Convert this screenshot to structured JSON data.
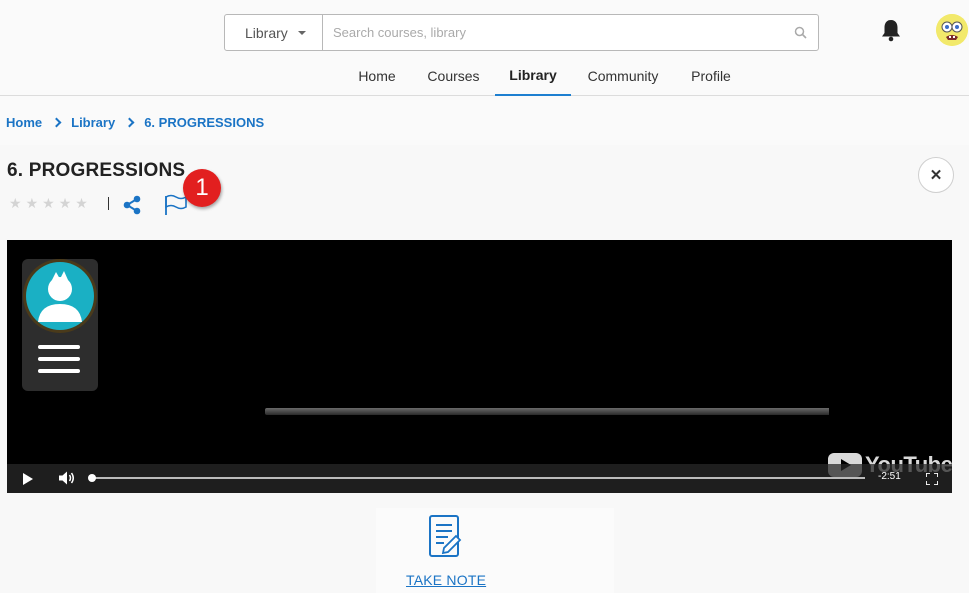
{
  "search": {
    "category": "Library",
    "placeholder": "Search courses, library"
  },
  "nav": {
    "items": [
      {
        "label": "Home"
      },
      {
        "label": "Courses"
      },
      {
        "label": "Library",
        "active": true
      },
      {
        "label": "Community"
      },
      {
        "label": "Profile"
      }
    ]
  },
  "breadcrumb": [
    "Home",
    "Library",
    "6. PROGRESSIONS"
  ],
  "item": {
    "title": "6. PROGRESSIONS",
    "rating": 0,
    "rating_max": 5
  },
  "annotation": {
    "badge": "1"
  },
  "video": {
    "time_remaining": "-2:51",
    "progress": 0
  },
  "take_note": {
    "label": "TAKE NOTE"
  },
  "colors": {
    "link": "#1b74c5",
    "nav_active": "#1d7fd0",
    "badge": "#e21f1f",
    "channel_avatar": "#1ab0c4"
  },
  "icons": [
    "search-icon",
    "bell-icon",
    "share-icon",
    "flag-icon",
    "close-icon",
    "play-icon",
    "volume-icon",
    "fullscreen-icon",
    "note-icon"
  ]
}
